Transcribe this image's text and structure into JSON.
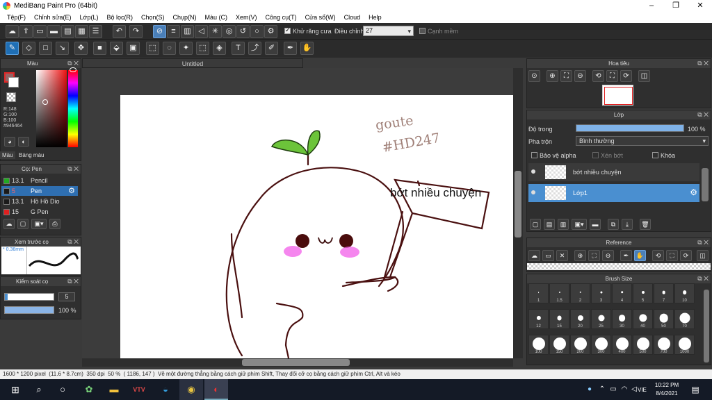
{
  "window": {
    "title": "MediBang Paint Pro (64bit)",
    "minimize": "–",
    "restore": "❐",
    "close": "✕"
  },
  "menu": [
    "Tệp(F)",
    "Chỉnh sửa(E)",
    "Lớp(L)",
    "Bộ lọc(R)",
    "Chọn(S)",
    "Chụp(N)",
    "Màu (C)",
    "Xem(V)",
    "Công cụ(T)",
    "Cửa sổ(W)",
    "Cloud",
    "Help"
  ],
  "toolbar": {
    "antialias_label": "Khử răng cưa",
    "correction_label": "Điều chỉnh",
    "correction_value": "27",
    "edge_label": "Cạnh mềm"
  },
  "color_panel": {
    "title": "Màu",
    "rgb": [
      "R:148",
      "G:100",
      "B:100",
      "#946464"
    ],
    "tabs": [
      "Màu",
      "Bảng màu"
    ],
    "primary_color": "#946464"
  },
  "brush_panel": {
    "title": "Cọ: Pen",
    "items": [
      {
        "size": "13.1",
        "name": "Pencil",
        "color": "#22aa22"
      },
      {
        "size": "5",
        "name": "Pen",
        "color": "#1a1a1a",
        "selected": true
      },
      {
        "size": "13.1",
        "name": "Hồ Hồ Dio",
        "color": "#1a1a1a"
      },
      {
        "size": "15",
        "name": "G Pen",
        "color": "#e02020"
      }
    ]
  },
  "preview_panel": {
    "title": "Xem trước cọ",
    "size_label": "* 0.36mm"
  },
  "control_panel": {
    "title": "Kiểm soát cọ",
    "size_value": "5",
    "opacity_value": "100 %",
    "opacity_level": 1.0
  },
  "canvas": {
    "tab_title": "Untitled",
    "handwriting_1": "goute",
    "handwriting_2": "#HD247",
    "sign_text": "bớt nhiều chuyện"
  },
  "navigator": {
    "title": "Hoa tiêu"
  },
  "layer_panel": {
    "title": "Lớp",
    "opacity_label": "Độ trong",
    "opacity_value": "100 %",
    "opacity_level": 1.0,
    "blend_label": "Pha trộn",
    "blend_value": "Bình thường",
    "protect_alpha": "Bảo vệ alpha",
    "clipping": "Xén bớt",
    "lock": "Khóa",
    "layers": [
      {
        "name": "bớt nhiều chuyện",
        "selected": false
      },
      {
        "name": "Lớp1",
        "selected": true
      }
    ]
  },
  "reference_panel": {
    "title": "Reference"
  },
  "brush_size_panel": {
    "title": "Brush Size",
    "sizes": [
      "1",
      "1.5",
      "2",
      "3",
      "4",
      "5",
      "7",
      "10",
      "12",
      "15",
      "20",
      "25",
      "30",
      "40",
      "50",
      "70",
      "100",
      "150",
      "200",
      "300",
      "400",
      "500",
      "700",
      "1000"
    ]
  },
  "status": {
    "dims": "1600 * 1200 pixel",
    "physical": "(11.6 * 8.7cm)",
    "dpi": "350 dpi",
    "zoom": "50 %",
    "coords": "( 1186, 147 )",
    "hint": "Vẽ một đường thẳng bằng cách giữ phím Shift, Thay đổi cỡ cọ bằng cách giữ phím Ctrl, Alt và kéo"
  },
  "taskbar": {
    "lang": "VIE",
    "time": "10:22 PM",
    "date": "8/4/2021"
  }
}
